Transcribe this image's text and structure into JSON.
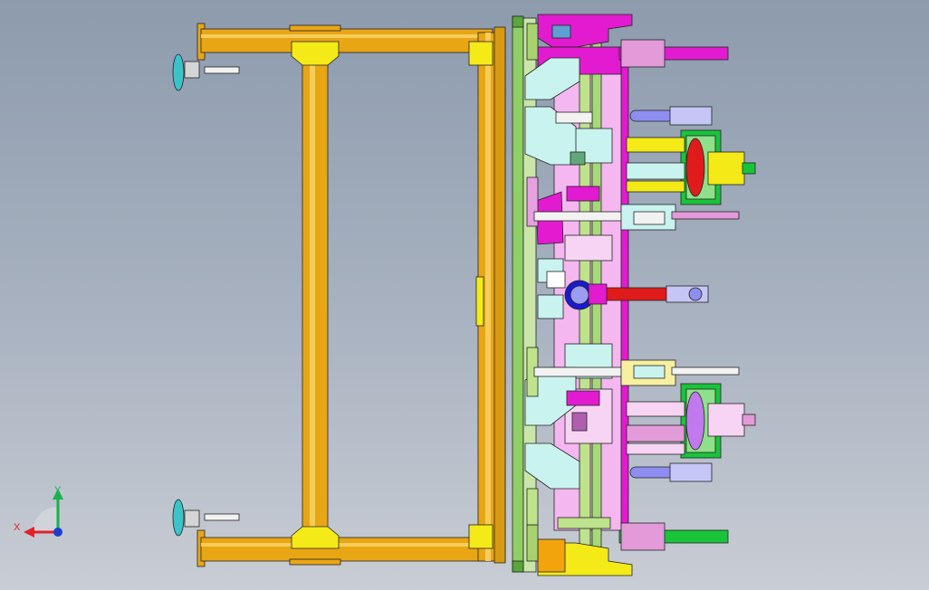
{
  "viewport": {
    "background_top": "#8d9bad",
    "background_bottom": "#c9cdd4",
    "model": "welding-fixture-assembly"
  },
  "triad": {
    "x_label": "X",
    "y_label": "Y",
    "x_color": "#e0202a",
    "y_color": "#19b14a",
    "origin_color": "#1a3fd0"
  },
  "colors": {
    "frame_gold": "#e9a614",
    "frame_edge": "#6b4b05",
    "corner_yellow": "#f3ea17",
    "magenta": "#e21bd0",
    "pink": "#f4b7f0",
    "light_green": "#bfe28c",
    "cyan_light": "#c9f3ef",
    "green": "#19c43a",
    "red": "#e01b1b",
    "blue_cyl": "#8e8ef0",
    "teal": "#3cc3c8"
  }
}
